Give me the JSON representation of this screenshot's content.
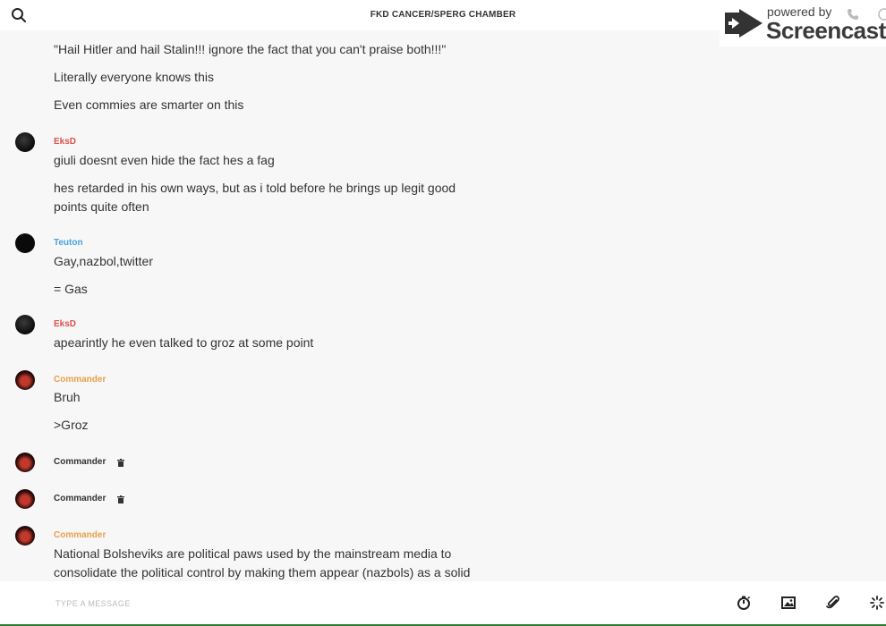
{
  "header": {
    "title": "FKD CANCER/SPERG CHAMBER"
  },
  "watermark": {
    "top_text": "powered by",
    "brand": "Screencastify"
  },
  "messages": {
    "m1": "\"Hail Hitler and hail Stalin!!! ignore the fact that you can't praise both!!!\"",
    "m2": "Literally everyone knows this",
    "m3": "Even commies are smarter on this",
    "g1_author": "EksD",
    "m4": "giuli doesnt even hide the fact hes a fag",
    "m5a": "hes retarded in his own ways, but as i told before he brings up legit good",
    "m5b": "points quite often",
    "g2_author": "Teuton",
    "m6": "Gay,nazbol,twitter",
    "m7": "= Gas",
    "g3_author": "EksD",
    "m8": "apearintly he even talked to groz at some point",
    "g4_author": "Commander",
    "m9": "Bruh",
    "m10": ">Groz",
    "g5_author": "Commander",
    "g6_author": "Commander",
    "g7_author": "Commander",
    "m11a": "National Bolsheviks are political paws used by the mainstream media to",
    "m11b": "consolidate the political control by making them appear (nazbols) as a solid"
  },
  "composer": {
    "placeholder": "TYPE A MESSAGE"
  },
  "colors": {
    "eksd": "#d9534f",
    "teuton": "#4aa3df",
    "commander": "#e8a04b",
    "accent_bar": "#2e7d32"
  },
  "icons": [
    "search-icon",
    "phone-icon",
    "info-icon",
    "trash-icon",
    "timer-icon",
    "image-icon",
    "paperclip-icon",
    "sparkle-icon"
  ]
}
